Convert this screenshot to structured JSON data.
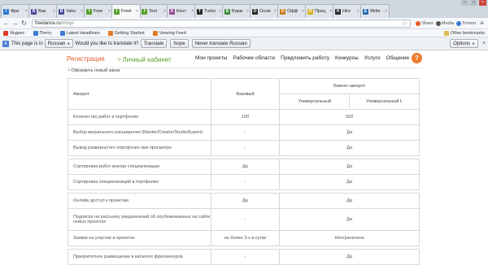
{
  "browser": {
    "tabs": [
      {
        "title": "Фри",
        "color": "#2a7bd4",
        "glyph": "f",
        "active": false
      },
      {
        "title": "Вак",
        "color": "#4a4a9a",
        "glyph": "В",
        "active": false
      },
      {
        "title": "Vako",
        "color": "#4a4a9a",
        "glyph": "В",
        "active": false
      },
      {
        "title": "Free",
        "color": "#5aa02c",
        "glyph": "f",
        "active": false
      },
      {
        "title": "Freel",
        "color": "#5aa02c",
        "glyph": "f",
        "active": true
      },
      {
        "title": "Text",
        "color": "#5aa02c",
        "glyph": "f",
        "active": false
      },
      {
        "title": "Конт",
        "color": "#9a4a9a",
        "glyph": "К",
        "active": false
      },
      {
        "title": "Turbo",
        "color": "#2a2a2a",
        "glyph": "T",
        "active": false
      },
      {
        "title": "Бирж",
        "color": "#3a8a3a",
        "glyph": "Б",
        "active": false
      },
      {
        "title": "Онли",
        "color": "#2a2a2a",
        "glyph": "О",
        "active": false
      },
      {
        "title": "Офф",
        "color": "#cc7a1a",
        "glyph": "О",
        "active": false
      },
      {
        "title": "Проц",
        "color": "#d8b22a",
        "glyph": "П",
        "active": false
      },
      {
        "title": "Hire",
        "color": "#2a2a2a",
        "glyph": "H",
        "active": false
      },
      {
        "title": "Write",
        "color": "#2a6ab4",
        "glyph": "E",
        "active": false
      }
    ],
    "url_host": "freelance.ru",
    "url_path": "/shop/",
    "extensions": [
      {
        "label": "Share",
        "color": "#e05a2a"
      },
      {
        "label": "Media",
        "color": "#555555"
      },
      {
        "label": "Torrent",
        "color": "#3a7bd4"
      }
    ],
    "bookmarks": [
      {
        "label": "Яндекс",
        "color": "#e03a2a"
      },
      {
        "label": "Почту",
        "color": "#3a7bd4"
      },
      {
        "label": "Latest Headlines",
        "color": "#3a7bd4"
      },
      {
        "label": "Getting Started",
        "color": "#e07a2a"
      },
      {
        "label": "Viewing Feed",
        "color": "#e07a2a"
      }
    ],
    "other_bookmarks": "Other bookmarks"
  },
  "translate_bar": {
    "prefix": "This page is in",
    "language": "Russian",
    "question": "Would you like to translate it?",
    "translate": "Translate",
    "nope": "Nope",
    "never": "Never translate Russian",
    "options": "Options"
  },
  "site": {
    "register": "Регистрация",
    "cabinet": "Личный кабинет",
    "nav": [
      "Мои проекты",
      "Рабочие области",
      "Предложить работу",
      "Конкурсы",
      "Услуги",
      "Общение"
    ],
    "help": "?"
  },
  "content": {
    "order_link": "• Оформить новый заказ",
    "table": {
      "head_account": "Аккаунт",
      "head_basic": "Базовый",
      "head_business": "Бизнес-аккаунт",
      "head_universal": "Универсальный",
      "head_universal_l": "Универсальный L",
      "rows": [
        {
          "label": "Количество работ в портфолио",
          "basic": "100",
          "business": "500",
          "gap_after": false
        },
        {
          "label": "Выбор визуального расширения (Master/Creator/Studio/Expert)",
          "basic": "-",
          "business": "Да",
          "gap_after": false
        },
        {
          "label": "Вывод развернутого портфолио при просмотре",
          "basic": "-",
          "business": "Да",
          "gap_after": true
        },
        {
          "label": "Сортировка работ внутри специализации",
          "basic": "Да",
          "business": "Да",
          "gap_after": false
        },
        {
          "label": "Сортировка специализаций в портфолио",
          "basic": "-",
          "business": "Да",
          "gap_after": true
        },
        {
          "label": "Онлайн доступ к проектам",
          "basic": "Да",
          "business": "Да",
          "gap_after": false
        },
        {
          "label": "Подписка на рассылку уведомлений об опубликованных на сайте новых проектах",
          "basic": "-",
          "business": "Да",
          "gap_after": false
        },
        {
          "label": "Заявки на участие в проектах",
          "basic": "не более 3-х в сутки",
          "business": "Неограничено",
          "gap_after": true
        },
        {
          "label": "Приоритетное размещение в каталоге фрилансеров",
          "basic": "-",
          "business": "Да",
          "gap_after": false
        }
      ]
    }
  }
}
